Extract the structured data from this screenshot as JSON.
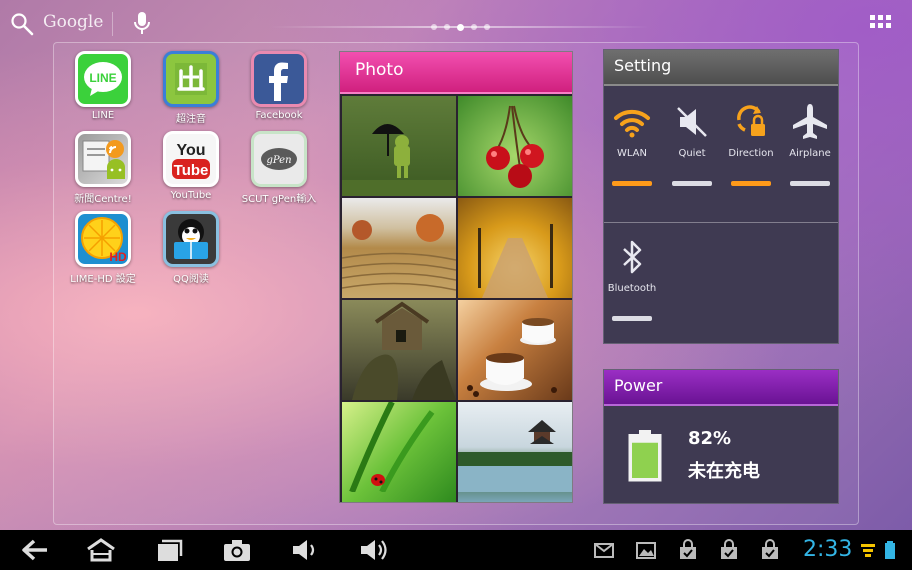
{
  "topbar": {
    "search_label": "Google",
    "search_icon": "search-icon",
    "mic_icon": "mic-icon",
    "page_count": 5,
    "active_page": 2
  },
  "apps": [
    {
      "label": "LINE"
    },
    {
      "label": "超注音"
    },
    {
      "label": "Facebook"
    },
    {
      "label": "新聞Centre!"
    },
    {
      "label": "YouTube"
    },
    {
      "label": "SCUT gPen輸入"
    },
    {
      "label": "LIME-HD 設定"
    },
    {
      "label": "QQ阅读"
    }
  ],
  "photo_widget": {
    "title": "Photo"
  },
  "setting_widget": {
    "title": "Setting",
    "toggles": [
      {
        "label": "WLAN",
        "icon": "wifi-icon",
        "state": "on"
      },
      {
        "label": "Quiet",
        "icon": "mute-icon",
        "state": "off"
      },
      {
        "label": "Direction",
        "icon": "rotation-lock-icon",
        "state": "on"
      },
      {
        "label": "Airplane",
        "icon": "airplane-icon",
        "state": "off"
      },
      {
        "label": "Bluetooth",
        "icon": "bluetooth-icon",
        "state": "off"
      }
    ]
  },
  "power_widget": {
    "title": "Power",
    "percent": "82%",
    "battery_level": 0.82,
    "status": "未在充电"
  },
  "navbar": {
    "clock": "2:33"
  },
  "colors": {
    "accent_blue": "#33b5e5",
    "toggle_on": "#ff9a1a",
    "photo_header": "#e8379c",
    "power_header": "#8a22b6",
    "battery_green": "#8fd14f"
  }
}
